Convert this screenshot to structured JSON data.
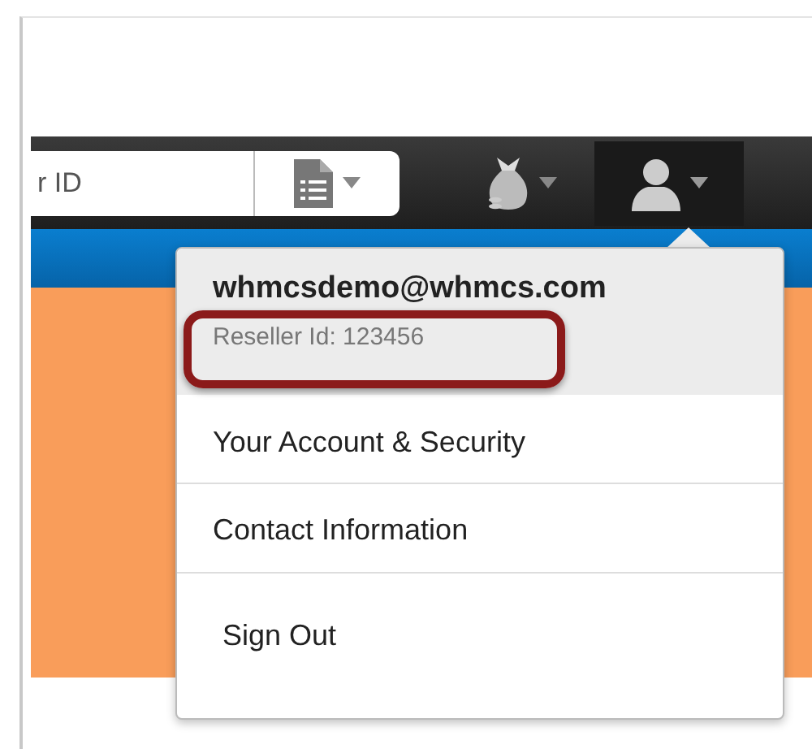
{
  "navbar": {
    "search": {
      "value": "r ID"
    }
  },
  "account_menu": {
    "email": "whmcsdemo@whmcs.com",
    "reseller_id": "Reseller Id: 123456",
    "items": [
      {
        "label": "Your Account & Security"
      },
      {
        "label": "Contact Information"
      },
      {
        "label": "Sign Out"
      }
    ]
  }
}
